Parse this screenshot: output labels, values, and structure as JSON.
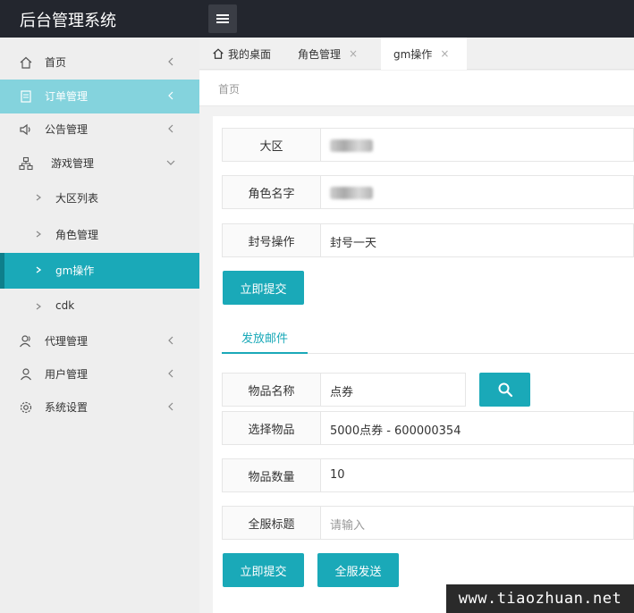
{
  "app": {
    "title": "后台管理系统"
  },
  "sidebar": {
    "items": [
      {
        "label": "首页",
        "icon": "home-icon"
      },
      {
        "label": "订单管理",
        "icon": "document-icon"
      },
      {
        "label": "公告管理",
        "icon": "speaker-icon"
      },
      {
        "label": "游戏管理",
        "icon": "sitemap-icon"
      },
      {
        "label": "大区列表"
      },
      {
        "label": "角色管理"
      },
      {
        "label": "gm操作"
      },
      {
        "label": "cdk"
      },
      {
        "label": "代理管理",
        "icon": "users-icon"
      },
      {
        "label": "用户管理",
        "icon": "user-icon"
      },
      {
        "label": "系统设置",
        "icon": "gear-icon"
      }
    ]
  },
  "tabs": [
    {
      "label": "我的桌面"
    },
    {
      "label": "角色管理",
      "close": "×"
    },
    {
      "label": "gm操作",
      "close": "×"
    }
  ],
  "breadcrumb": "首页",
  "form1": {
    "region_label": "大区",
    "role_label": "角色名字",
    "ban_label": "封号操作",
    "ban_value": "封号一天",
    "submit": "立即提交"
  },
  "mail": {
    "tab": "发放邮件",
    "item_name_label": "物品名称",
    "item_name_value": "点券",
    "select_label": "选择物品",
    "select_value": "5000点券 - 600000354",
    "qty_label": "物品数量",
    "qty_value": "10",
    "title_label": "全服标题",
    "title_placeholder": "请输入",
    "submit": "立即提交",
    "broadcast": "全服发送"
  },
  "watermark": "www.tiaozhuan.net",
  "colors": {
    "accent": "#1aa9b8",
    "header": "#23262e",
    "highlight": "#84d3dd"
  }
}
